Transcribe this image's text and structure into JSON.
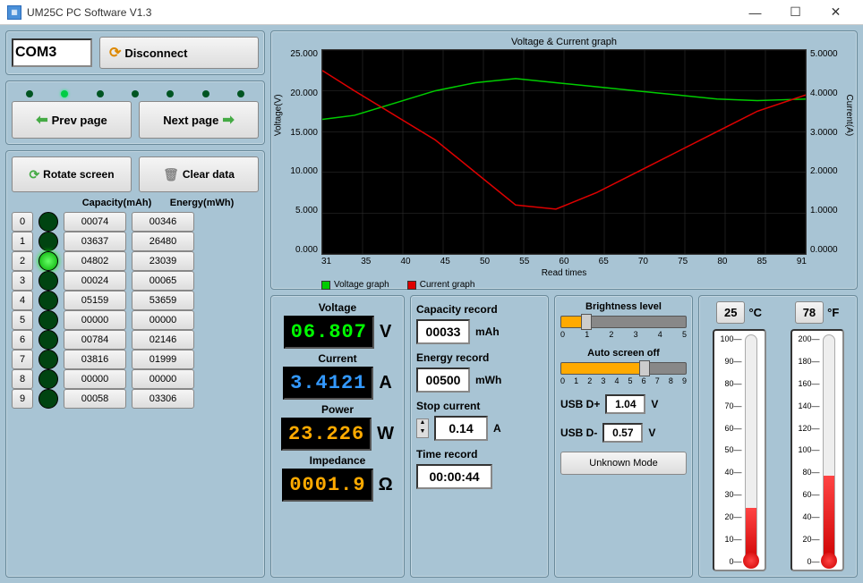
{
  "window": {
    "title": "UM25C PC Software V1.3"
  },
  "connection": {
    "port": "COM3",
    "disconnect_label": "Disconnect"
  },
  "nav": {
    "prev": "Prev page",
    "next": "Next page"
  },
  "action": {
    "rotate": "Rotate screen",
    "clear": "Clear data"
  },
  "table": {
    "hdr_capacity": "Capacity(mAh)",
    "hdr_energy": "Energy(mWh)",
    "rows": [
      {
        "idx": "0",
        "on": false,
        "cap": "00074",
        "en": "00346"
      },
      {
        "idx": "1",
        "on": false,
        "cap": "03637",
        "en": "26480"
      },
      {
        "idx": "2",
        "on": true,
        "cap": "04802",
        "en": "23039"
      },
      {
        "idx": "3",
        "on": false,
        "cap": "00024",
        "en": "00065"
      },
      {
        "idx": "4",
        "on": false,
        "cap": "05159",
        "en": "53659"
      },
      {
        "idx": "5",
        "on": false,
        "cap": "00000",
        "en": "00000"
      },
      {
        "idx": "6",
        "on": false,
        "cap": "00784",
        "en": "02146"
      },
      {
        "idx": "7",
        "on": false,
        "cap": "03816",
        "en": "01999"
      },
      {
        "idx": "8",
        "on": false,
        "cap": "00000",
        "en": "00000"
      },
      {
        "idx": "9",
        "on": false,
        "cap": "00058",
        "en": "03306"
      }
    ]
  },
  "chart_data": {
    "type": "line",
    "title": "Voltage & Current graph",
    "xlabel": "Read times",
    "ylabel_left": "Voltage(V)",
    "ylabel_right": "Current(A)",
    "x": [
      31,
      35,
      40,
      45,
      50,
      55,
      60,
      65,
      70,
      75,
      80,
      85,
      91
    ],
    "y_ticks_left": [
      "25.000",
      "20.000",
      "15.000",
      "10.000",
      "5.000",
      "0.000"
    ],
    "y_ticks_right": [
      "5.0000",
      "4.0000",
      "3.0000",
      "2.0000",
      "1.0000",
      "0.0000"
    ],
    "x_ticks": [
      "31",
      "35",
      "40",
      "45",
      "50",
      "55",
      "60",
      "65",
      "70",
      "75",
      "80",
      "85",
      "91"
    ],
    "ylim_left": [
      0,
      25
    ],
    "ylim_right": [
      0,
      5
    ],
    "series": [
      {
        "name": "Voltage graph",
        "color": "#0c0",
        "axis": "left",
        "values": [
          16.5,
          17.0,
          18.5,
          20.0,
          21.0,
          21.5,
          21.0,
          20.5,
          20.0,
          19.5,
          19.0,
          18.8,
          19.0
        ]
      },
      {
        "name": "Current graph",
        "color": "#d00",
        "axis": "right",
        "values": [
          4.5,
          4.0,
          3.4,
          2.8,
          2.0,
          1.2,
          1.1,
          1.5,
          2.0,
          2.5,
          3.0,
          3.5,
          3.9
        ]
      }
    ]
  },
  "measure": {
    "voltage_label": "Voltage",
    "voltage": "06.807",
    "voltage_unit": "V",
    "current_label": "Current",
    "current": "3.4121",
    "current_unit": "A",
    "power_label": "Power",
    "power": "23.226",
    "power_unit": "W",
    "impedance_label": "Impedance",
    "impedance": "0001.9",
    "impedance_unit": "Ω"
  },
  "record": {
    "cap_label": "Capacity record",
    "cap": "00033",
    "cap_unit": "mAh",
    "en_label": "Energy record",
    "en": "00500",
    "en_unit": "mWh",
    "stop_label": "Stop current",
    "stop": "0.14",
    "stop_unit": "A",
    "time_label": "Time record",
    "time": "00:00:44"
  },
  "control": {
    "bright_label": "Brightness level",
    "bright_val": 1,
    "bright_max": 5,
    "bright_ticks": [
      "0",
      "1",
      "2",
      "3",
      "4",
      "5"
    ],
    "auto_label": "Auto screen off",
    "auto_val": 6,
    "auto_max": 9,
    "auto_ticks": [
      "0",
      "1",
      "2",
      "3",
      "4",
      "5",
      "6",
      "7",
      "8",
      "9"
    ],
    "usbdp_label": "USB D+",
    "usbdp": "1.04",
    "usbdp_unit": "V",
    "usbdm_label": "USB D-",
    "usbdm": "0.57",
    "usbdm_unit": "V",
    "mode": "Unknown Mode"
  },
  "thermo": {
    "c_val": "25",
    "c_unit": "°C",
    "c_scale": [
      "100",
      "90",
      "80",
      "70",
      "60",
      "50",
      "40",
      "30",
      "20",
      "10",
      "0"
    ],
    "c_pct": 25,
    "f_val": "78",
    "f_unit": "°F",
    "f_scale": [
      "200",
      "180",
      "160",
      "140",
      "120",
      "100",
      "80",
      "60",
      "40",
      "20",
      "0"
    ],
    "f_pct": 39
  }
}
